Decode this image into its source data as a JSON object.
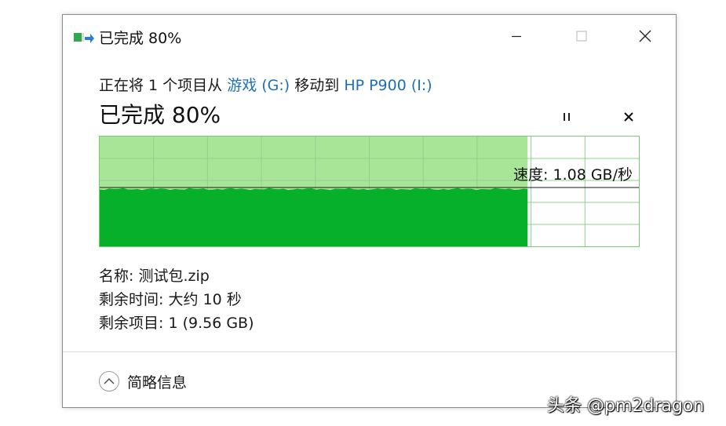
{
  "window": {
    "title": "已完成 80%",
    "icon": "file-move-icon"
  },
  "message": {
    "prefix": "正在将 1 个项目从 ",
    "source": "游戏 (G:)",
    "middle": " 移动到 ",
    "destination": "HP P900 (I:)"
  },
  "progress": {
    "heading": "已完成 80%",
    "fraction": 0.8,
    "speed": "速度: 1.08 GB/秒"
  },
  "details": {
    "name": "名称: 测试包.zip",
    "time_remaining": "剩余时间: 大约 10 秒",
    "items_remaining": "剩余项目: 1 (9.56 GB)"
  },
  "footer": {
    "less_details": "简略信息"
  },
  "watermark": "头条 @pm2dragon",
  "colors": {
    "link": "#1f6fb8",
    "graph_fill": "#06b02b",
    "graph_light": "#a8e596",
    "graph_grid": "#8fd18f"
  }
}
